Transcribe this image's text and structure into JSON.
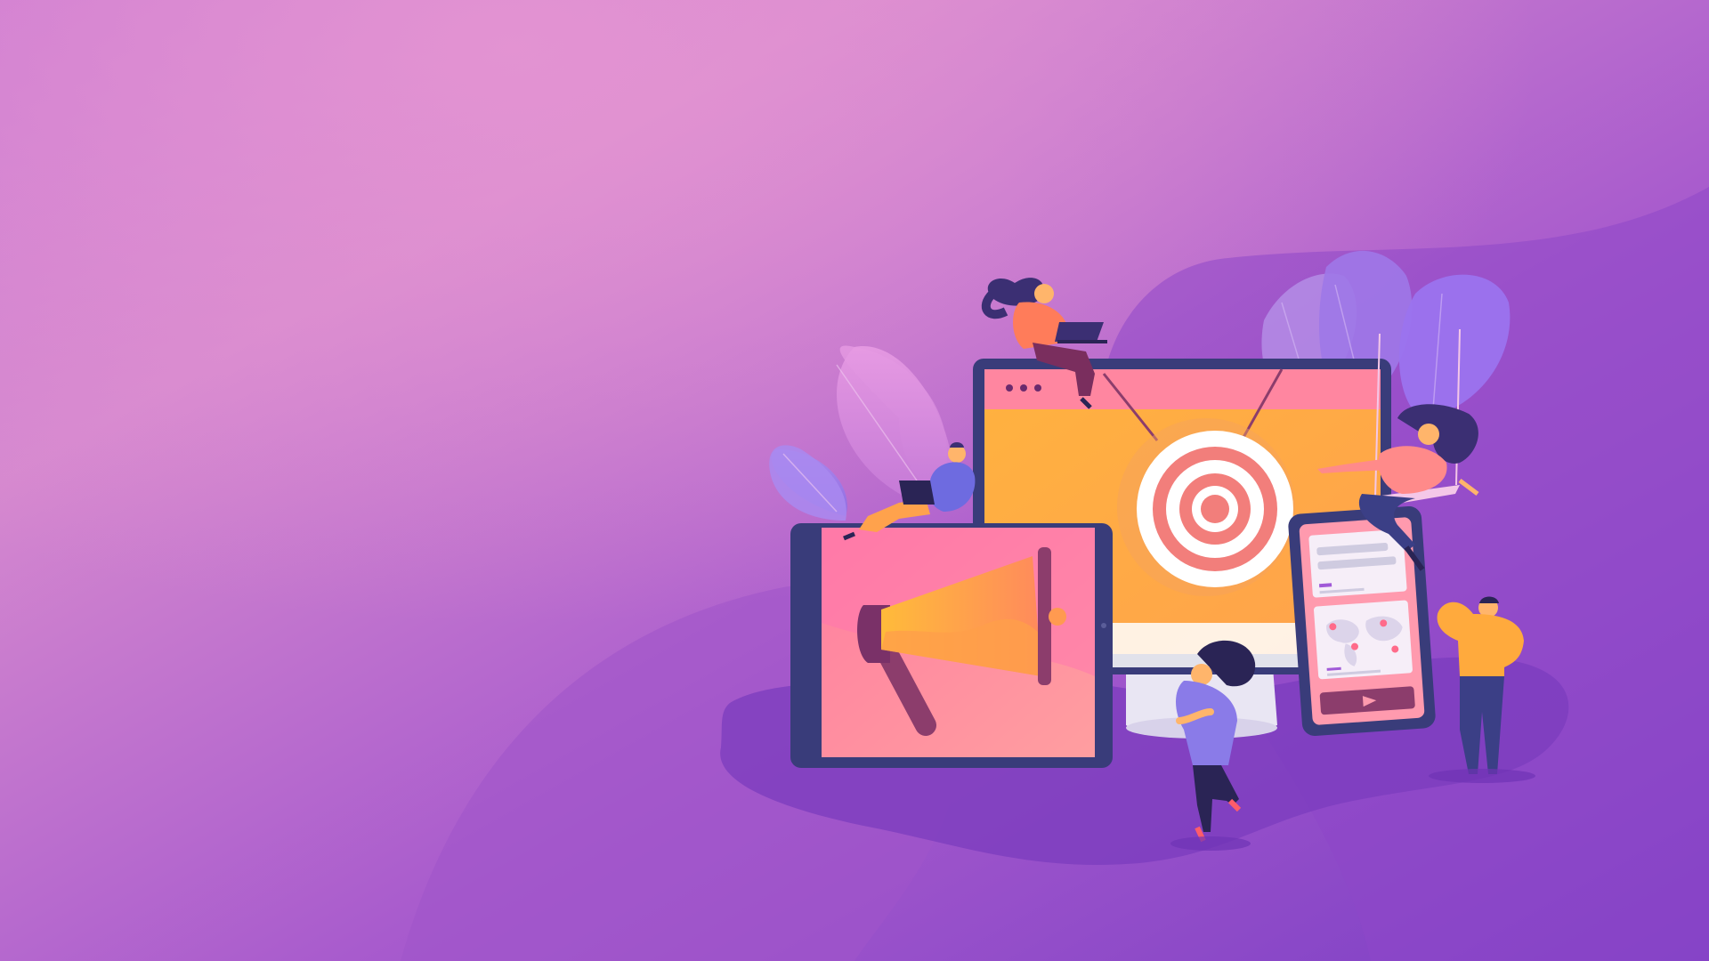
{
  "scene": {
    "subject": "digital-marketing-illustration",
    "icons": [
      "target-icon",
      "megaphone-icon",
      "world-map-icon",
      "play-icon",
      "location-pin-icon"
    ],
    "colors": {
      "bg_light": "#d789cf",
      "bg_mid": "#a658cc",
      "bg_dark": "#7f3fc4",
      "accent_orange": "#ffb340",
      "accent_pink": "#ff7ea3",
      "target_ring": "#f27e7b",
      "device_frame": "#3a3d7c",
      "shadow_purple": "#7c3fbf"
    }
  }
}
